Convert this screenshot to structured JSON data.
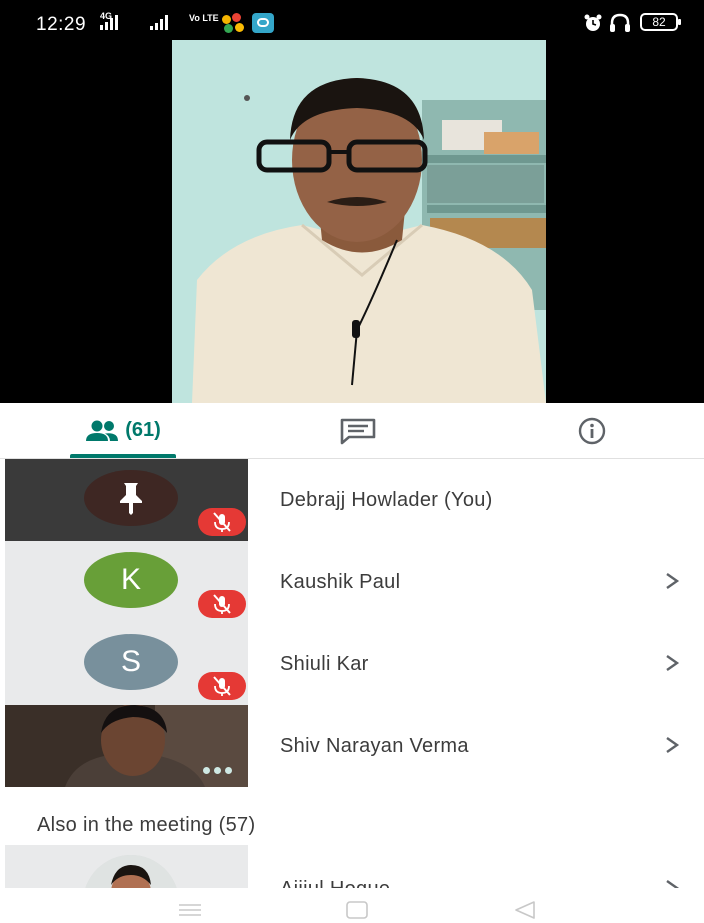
{
  "status_bar": {
    "time": "12:29",
    "network_label": "4G",
    "volte_label": "Vo LTE",
    "battery_level": "82"
  },
  "tabs": {
    "people_count": "(61)",
    "active": "people"
  },
  "participants": [
    {
      "name": "Debrajj Howlader (You)",
      "avatar_letter": "",
      "avatar_color": "#3e2723",
      "muted": true,
      "has_chevron": false,
      "thumb_bg": "#3a3a3a"
    },
    {
      "name": "Kaushik Paul",
      "avatar_letter": "K",
      "avatar_color": "#689f38",
      "muted": true,
      "has_chevron": true,
      "thumb_bg": "#e9eaeb"
    },
    {
      "name": "Shiuli Kar",
      "avatar_letter": "S",
      "avatar_color": "#78909c",
      "muted": true,
      "has_chevron": true,
      "thumb_bg": "#e9eaeb"
    },
    {
      "name": "Shiv Narayan Verma",
      "avatar_letter": "",
      "avatar_color": "",
      "muted": false,
      "has_chevron": true,
      "thumb_bg": "#2b2420"
    }
  ],
  "also_in_meeting": {
    "title": "Also in the meeting (57)",
    "first_name": "Aijiul Hoque"
  },
  "colors": {
    "accent": "#00796b",
    "mute_red": "#e53935"
  }
}
